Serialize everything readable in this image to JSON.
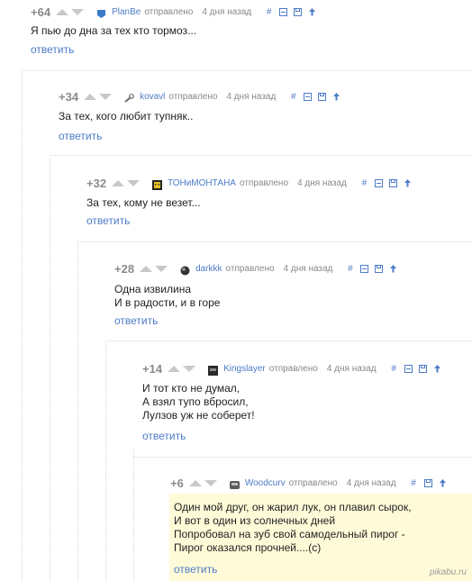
{
  "comments": [
    {
      "score": "+64",
      "user": "PlanBe",
      "sent": "отправлено",
      "time": "4 дня назад",
      "lines": [
        "Я пью до дна за тех кто тормоз..."
      ],
      "reply": "ответить",
      "avatar_icon": "blue-badge-avatar-icon"
    },
    {
      "score": "+34",
      "user": "kovavl",
      "sent": "отправлено",
      "time": "4 дня назад",
      "lines": [
        "За тех, кого любит тупняк.."
      ],
      "reply": "ответить",
      "avatar_icon": "wrench-avatar-icon"
    },
    {
      "score": "+32",
      "user": "ТОНиМОНТАНА",
      "sent": "отправлено",
      "time": "4 дня назад",
      "lines": [
        "За тех, кому не везет..."
      ],
      "reply": "ответить",
      "avatar_icon": "yellow-robot-avatar-icon"
    },
    {
      "score": "+28",
      "user": "darkkk",
      "sent": "отправлено",
      "time": "4 дня назад",
      "lines": [
        "Одна извилина",
        "И в радости, и в горе"
      ],
      "reply": "ответить",
      "avatar_icon": "dark-sphere-avatar-icon"
    },
    {
      "score": "+14",
      "user": "Kingslayer",
      "sent": "отправлено",
      "time": "4 дня назад",
      "lines": [
        "И тот кто не думал,",
        "А взял тупо вбросил,",
        "Лулзов уж не соберет!"
      ],
      "reply": "ответить",
      "avatar_icon": "dark-helmet-avatar-icon"
    },
    {
      "score": "+6",
      "user": "Woodcurv",
      "sent": "отправлено",
      "time": "4 дня назад",
      "lines": [
        "Один мой друг, он жарил лук, он плавил сырок,",
        "И вот в один из солнечных дней",
        "Попробовал на зуб свой самодельный пирог -",
        "Пирог оказался прочней....(с)"
      ],
      "reply": "ответить",
      "avatar_icon": "grey-block-avatar-icon"
    }
  ],
  "action_icons": [
    "hash-icon",
    "collapse-icon",
    "save-icon",
    "up-arrow-icon"
  ],
  "watermark": "pikabu.ru",
  "colors": {
    "link": "#4d7bc7",
    "score": "#8b8b8b",
    "highlight": "#fffbd8",
    "arrow": "#c8c8c8"
  }
}
